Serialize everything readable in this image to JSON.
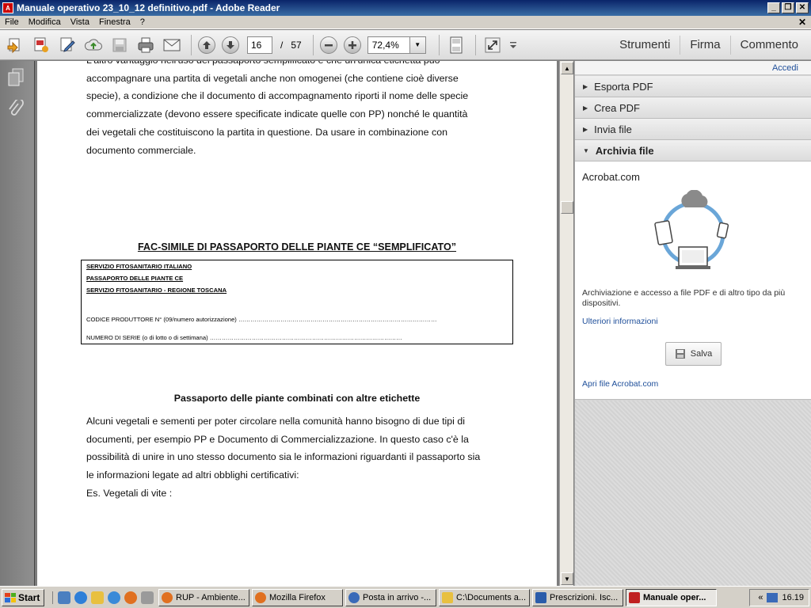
{
  "window": {
    "title": "Manuale operativo 23_10_12 definitivo.pdf - Adobe Reader",
    "minimize": "_",
    "maximize": "❐",
    "close": "✕"
  },
  "menu": {
    "items": [
      "File",
      "Modifica",
      "Vista",
      "Finestra",
      "?"
    ],
    "close_doc": "✕"
  },
  "toolbar": {
    "current_page": "16",
    "page_separator": "/",
    "total_pages": "57",
    "zoom": "72,4%",
    "right_tabs": [
      "Strumenti",
      "Firma",
      "Commento"
    ]
  },
  "document": {
    "intro_lines": [
      "L'altro vantaggio nell'uso del passaporto semplificato è che un'unica etichetta può",
      "accompagnare una partita di vegetali anche non omogenei (che contiene cioè diverse",
      "specie), a condizione che il documento di accompagnamento riporti il nome delle specie",
      "commercializzate (devono essere specificate indicate quelle con PP)  nonché le quantità",
      "dei vegetali che costituiscono la partita in questione. Da usare in combinazione con",
      "documento commerciale."
    ],
    "facsimile_heading": "FAC-SIMILE DI PASSAPORTO DELLE PIANTE CE “SEMPLIFICATO”",
    "box": {
      "line1": "SERVIZIO FITOSANITARIO ITALIANO",
      "line2": "PASSAPORTO DELLE PIANTE CE",
      "line3": "SERVIZIO FITOSANITARIO  - REGIONE TOSCANA",
      "line4": "CODICE PRODUTTORE  N° (09/numero autorizzazione) ………………………………………………………………………………………",
      "line5": "NUMERO DI SERIE (o di lotto o di settimana) ……………………………………………………………………………………"
    },
    "section_heading": "Passaporto delle piante combinati con altre etichette",
    "body_lines": [
      "Alcuni vegetali e sementi per poter circolare nella comunità hanno bisogno di due tipi di",
      "documenti, per esempio PP e Documento di Commercializzazione. In questo caso c'è la",
      "possibilità di unire in uno stesso documento sia le informazioni riguardanti il passaporto sia",
      "le informazioni legate ad altri obblighi certificativi:"
    ],
    "example_line": "Es. Vegetali di vite :"
  },
  "panel": {
    "sign_in": "Accedi",
    "sections": [
      "Esporta PDF",
      "Crea PDF",
      "Invia file",
      "Archivia file"
    ],
    "archive": {
      "title": "Acrobat.com",
      "description": "Archiviazione e accesso a file PDF e di altro tipo da più dispositivi.",
      "more_info": "Ulteriori informazioni",
      "save_label": "Salva",
      "open_link": "Apri file Acrobat.com"
    }
  },
  "taskbar": {
    "start_label": "Start",
    "tasks": [
      "RUP - Ambiente...",
      "Mozilla Firefox",
      "Posta in arrivo -...",
      "C:\\Documents a...",
      "Prescrizioni. Isc...",
      "Manuale oper..."
    ],
    "tray_expand": "«",
    "clock": "16.19"
  },
  "colors": {
    "title_bar": "#0a246a",
    "link": "#1f4f9a",
    "panel_bg": "#d5d5d5",
    "cloud_ring": "#6aa6d8"
  }
}
